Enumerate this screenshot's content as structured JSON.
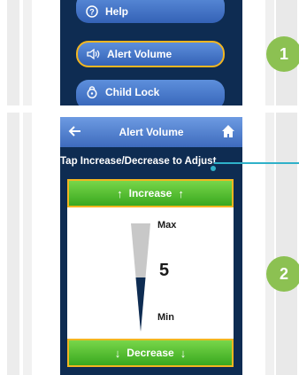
{
  "panel1": {
    "menu": [
      {
        "label": "Help",
        "icon": "help-icon"
      },
      {
        "label": "Alert Volume",
        "icon": "speaker-icon"
      },
      {
        "label": "Child Lock",
        "icon": "lock-icon"
      }
    ]
  },
  "steps": {
    "one": "1",
    "two": "2"
  },
  "panel2": {
    "title": "Alert Volume",
    "instruction": "Tap Increase/Decrease to Adjust",
    "increase_label": "Increase",
    "decrease_label": "Decrease",
    "max_label": "Max",
    "min_label": "Min",
    "volume_value": "5",
    "volume_level": 0.5
  },
  "colors": {
    "screen_bg": "#0e2c52",
    "menu_button": "#3e6bbd",
    "highlight_border": "#f2b621",
    "green_button": "#4cb82c",
    "badge": "#8cc152",
    "connector": "#2fb1c9"
  }
}
